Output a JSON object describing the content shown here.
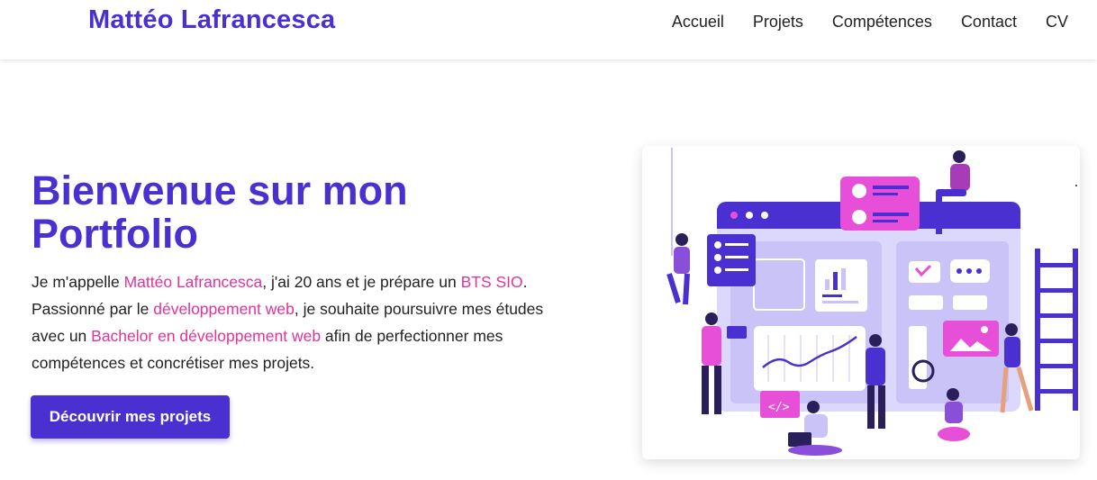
{
  "header": {
    "brand": "Mattéo Lafrancesca",
    "nav": [
      "Accueil",
      "Projets",
      "Compétences",
      "Contact",
      "CV"
    ]
  },
  "hero": {
    "title": "Bienvenue sur mon Portfolio",
    "intro_p1": "Je m'appelle ",
    "name": "Mattéo Lafrancesca",
    "intro_p2": ", j'ai 20 ans et je prépare un ",
    "bts": "BTS SIO",
    "intro_p3": ". Passionné par le ",
    "web_dev": "développement web",
    "intro_p4": ", je souhaite poursuivre mes études avec un ",
    "bachelor": "Bachelor en développement web",
    "intro_p5": " afin de perfectionner mes compétences et concrétiser mes projets.",
    "cta": "Découvrir mes projets"
  },
  "illustration": {
    "icon": "web-development-team-illustration",
    "colors": {
      "primary": "#4a2fd1",
      "light": "#c9c3f7",
      "pink": "#e84fd9"
    }
  },
  "colors": {
    "brand": "#4a2fd1",
    "highlight": "#e0339b"
  }
}
